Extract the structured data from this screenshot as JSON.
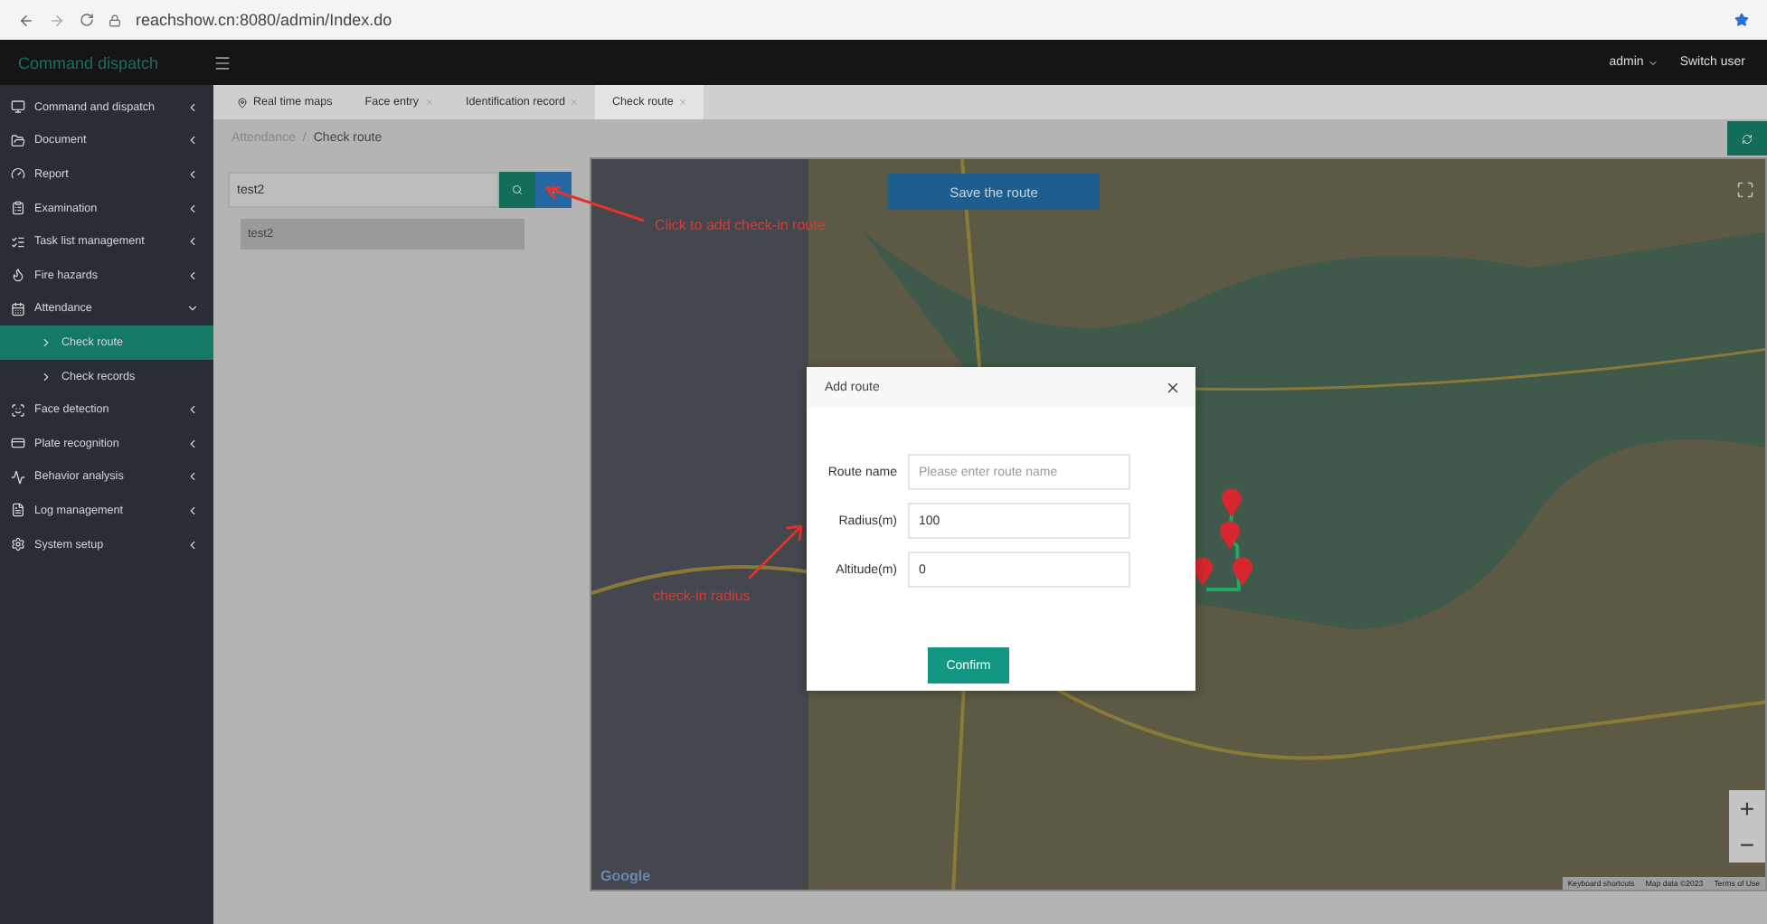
{
  "browser": {
    "url": "reachshow.cn:8080/admin/Index.do"
  },
  "header": {
    "brand": "Command dispatch",
    "user": "admin",
    "switch_user": "Switch user"
  },
  "sidebar": {
    "items": [
      {
        "label": "Command and dispatch",
        "expanded": false
      },
      {
        "label": "Document",
        "expanded": false
      },
      {
        "label": "Report",
        "expanded": false
      },
      {
        "label": "Examination",
        "expanded": false
      },
      {
        "label": "Task list management",
        "expanded": false
      },
      {
        "label": "Fire hazards",
        "expanded": false
      },
      {
        "label": "Attendance",
        "expanded": true,
        "children": [
          {
            "label": "Check route",
            "selected": true
          },
          {
            "label": "Check records",
            "selected": false
          }
        ]
      },
      {
        "label": "Face detection",
        "expanded": false
      },
      {
        "label": "Plate recognition",
        "expanded": false
      },
      {
        "label": "Behavior analysis",
        "expanded": false
      },
      {
        "label": "Log management",
        "expanded": false
      },
      {
        "label": "System setup",
        "expanded": false
      }
    ]
  },
  "tabs": [
    {
      "label": "Real time maps",
      "selected": false,
      "closable": false
    },
    {
      "label": "Face entry",
      "selected": false,
      "closable": true
    },
    {
      "label": "Identification record",
      "selected": false,
      "closable": true
    },
    {
      "label": "Check route",
      "selected": true,
      "closable": true
    }
  ],
  "breadcrumb": {
    "items": [
      "Attendance",
      "Check route"
    ],
    "separator": "/"
  },
  "search": {
    "value": "test2"
  },
  "tree": [
    {
      "label": "test2",
      "selected": true
    }
  ],
  "map": {
    "save_button": "Save the route",
    "zoom_in": "+",
    "zoom_out": "−",
    "logo": "Google",
    "attribution": [
      "Keyboard shortcuts",
      "Map data ©2023",
      "Terms of Use"
    ]
  },
  "annotations": [
    {
      "text": "Click to add check-in route"
    },
    {
      "text": "check-in radius"
    }
  ],
  "dialog": {
    "title": "Add route",
    "fields": [
      {
        "label": "Route name",
        "placeholder": "Please enter route name"
      },
      {
        "label": "Radius(m)",
        "value": "100"
      },
      {
        "label": "Altitude(m)",
        "value": "0"
      }
    ],
    "confirm": "Confirm"
  }
}
